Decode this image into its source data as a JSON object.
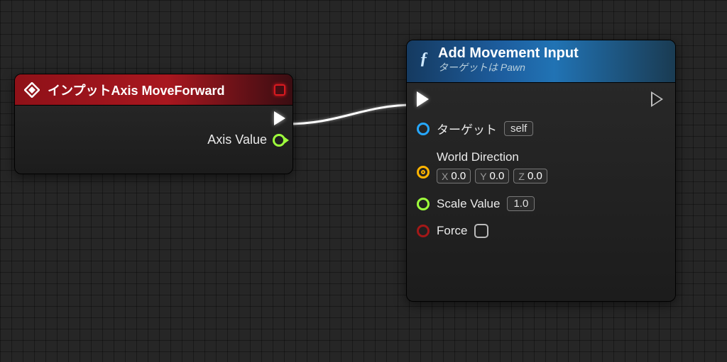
{
  "event_node": {
    "title": "インプットAxis MoveForward",
    "output_value_label": "Axis Value"
  },
  "func_node": {
    "title": "Add Movement Input",
    "subtitle": "ターゲットは Pawn",
    "pins": {
      "target_label": "ターゲット",
      "target_value": "self",
      "world_direction_label": "World Direction",
      "world_direction": {
        "x": "0.0",
        "y": "0.0",
        "z": "0.0"
      },
      "scale_value_label": "Scale Value",
      "scale_value": "1.0",
      "force_label": "Force",
      "force_checked": false
    }
  },
  "axis_labels": {
    "x": "X",
    "y": "Y",
    "z": "Z"
  },
  "icons": {
    "event_diamond": "event-icon",
    "function_f": "ƒ"
  }
}
